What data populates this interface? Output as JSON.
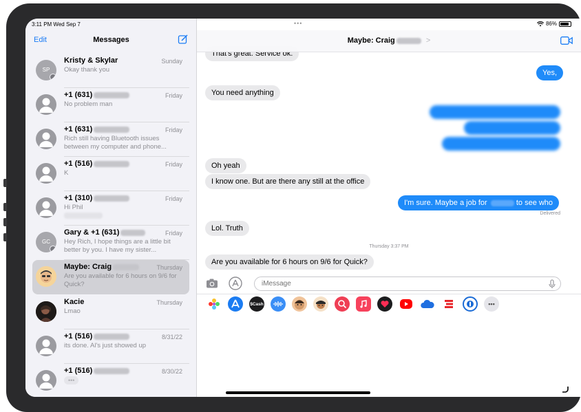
{
  "status_bar": {
    "time": "3:11 PM  Wed Sep 7",
    "dots": "•••",
    "battery": "86%",
    "battery_level": 0.86
  },
  "sidebar": {
    "edit_label": "Edit",
    "title": "Messages",
    "conversations": [
      {
        "name": "Kristy & Skylar",
        "date": "Sunday",
        "preview": "Okay thank you",
        "initials": "SP"
      },
      {
        "name": "+1 (631)",
        "date": "Friday",
        "preview": "No problem man"
      },
      {
        "name": "+1 (631)",
        "date": "Friday",
        "preview": "Rich still having Bluetooth issues between my computer and phone..."
      },
      {
        "name": "+1 (516)",
        "date": "Friday",
        "preview": "K"
      },
      {
        "name": "+1 (310)",
        "date": "Friday",
        "preview": "Hi Phil"
      },
      {
        "name": "Gary & +1 (631)",
        "date": "Friday",
        "preview": "Hey Rich, I hope things are a little bit better by you. I have my sister...",
        "initials": "GC"
      },
      {
        "name": "Maybe: Craig",
        "date": "Thursday",
        "preview": "Are you available for 6 hours on 9/6 for Quick?"
      },
      {
        "name": "Kacie",
        "date": "Thursday",
        "preview": "Lmao"
      },
      {
        "name": "+1 (516)",
        "date": "8/31/22",
        "preview": "its done. Al's just showed up"
      },
      {
        "name": "+1 (516)",
        "date": "8/30/22",
        "preview": "•••"
      }
    ]
  },
  "chat": {
    "title": "Maybe: Craig",
    "title_chevron": ">",
    "messages": [
      {
        "dir": "in",
        "text": "That's great. Service ok."
      },
      {
        "dir": "out",
        "text": "Yes,"
      },
      {
        "dir": "in",
        "text": "You need anything"
      },
      {
        "dir": "in",
        "text": "Oh yeah"
      },
      {
        "dir": "in",
        "text": "I know one. But are there any still at the office"
      },
      {
        "dir": "out",
        "text_before": "I'm sure. Maybe a job for",
        "text_after": "to see who"
      },
      {
        "dir": "in",
        "text": "Lol. Truth"
      },
      {
        "dir": "in",
        "text": "Are you available for 6 hours on 9/6 for Quick?"
      }
    ],
    "delivered_label": "Delivered",
    "timestamp": "Thursday 3:37 PM",
    "input_placeholder": "iMessage"
  },
  "app_strip": [
    {
      "name": "photos",
      "color": "#ffffff"
    },
    {
      "name": "app-store",
      "color": "#1b7cf2"
    },
    {
      "name": "cash",
      "color": "#1c1c1e",
      "label": "$Cash"
    },
    {
      "name": "audio",
      "color": "#3a8ef6"
    },
    {
      "name": "memoji-1",
      "color": "#f0c39a"
    },
    {
      "name": "memoji-2",
      "color": "#f5e1c8"
    },
    {
      "name": "search-images",
      "color": "#ef3f55"
    },
    {
      "name": "music",
      "color": "#f7425c"
    },
    {
      "name": "fitness",
      "color": "#1c1c1e"
    },
    {
      "name": "youtube",
      "color": "#ff0000"
    },
    {
      "name": "cloud",
      "color": "#1f6fe0"
    },
    {
      "name": "stripes",
      "color": "#e8262b"
    },
    {
      "name": "1password",
      "color": "#1a6bd6"
    },
    {
      "name": "more",
      "color": "#e5e5ea",
      "label": "•••"
    }
  ]
}
